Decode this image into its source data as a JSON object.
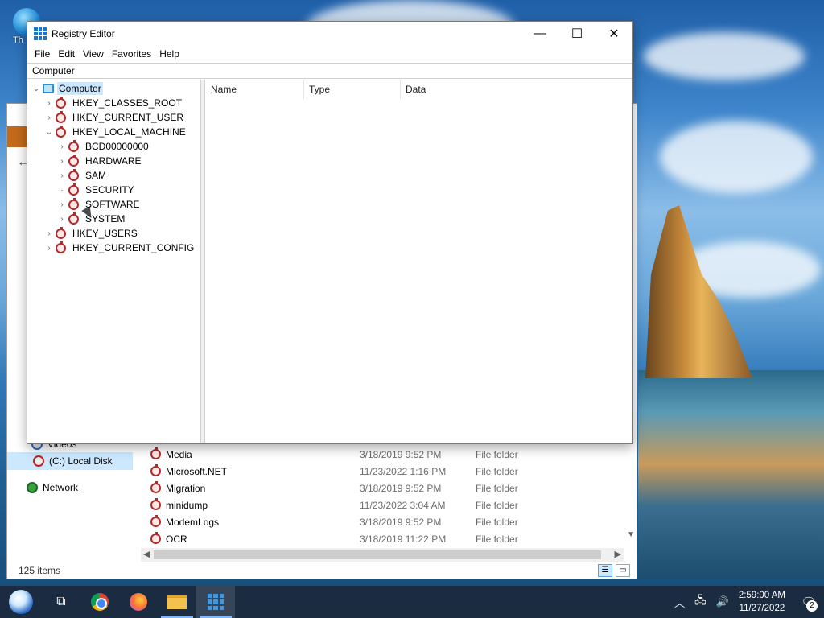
{
  "desktop": {
    "icon_label": "Th"
  },
  "explorer": {
    "nav": {
      "videos": "Videos",
      "local_disk": "(C:) Local Disk",
      "network": "Network"
    },
    "files": [
      {
        "name": "Media",
        "date": "3/18/2019 9:52 PM",
        "type": "File folder"
      },
      {
        "name": "Microsoft.NET",
        "date": "11/23/2022 1:16 PM",
        "type": "File folder"
      },
      {
        "name": "Migration",
        "date": "3/18/2019 9:52 PM",
        "type": "File folder"
      },
      {
        "name": "minidump",
        "date": "11/23/2022 3:04 AM",
        "type": "File folder"
      },
      {
        "name": "ModemLogs",
        "date": "3/18/2019 9:52 PM",
        "type": "File folder"
      },
      {
        "name": "OCR",
        "date": "3/18/2019 11:22 PM",
        "type": "File folder"
      }
    ],
    "status": "125 items"
  },
  "regedit": {
    "title": "Registry Editor",
    "menu": [
      "File",
      "Edit",
      "View",
      "Favorites",
      "Help"
    ],
    "address": "Computer",
    "tree": {
      "root": "Computer",
      "hives": [
        "HKEY_CLASSES_ROOT",
        "HKEY_CURRENT_USER",
        "HKEY_LOCAL_MACHINE",
        "HKEY_USERS",
        "HKEY_CURRENT_CONFIG"
      ],
      "hklm_children": [
        "BCD00000000",
        "HARDWARE",
        "SAM",
        "SECURITY",
        "SOFTWARE",
        "SYSTEM"
      ]
    },
    "columns": [
      "Name",
      "Type",
      "Data"
    ],
    "win_buttons": {
      "minimize": "—",
      "maximize": "☐",
      "close": "✕"
    }
  },
  "taskbar": {
    "time": "2:59:00 AM",
    "date": "11/27/2022",
    "notification_count": "2"
  }
}
